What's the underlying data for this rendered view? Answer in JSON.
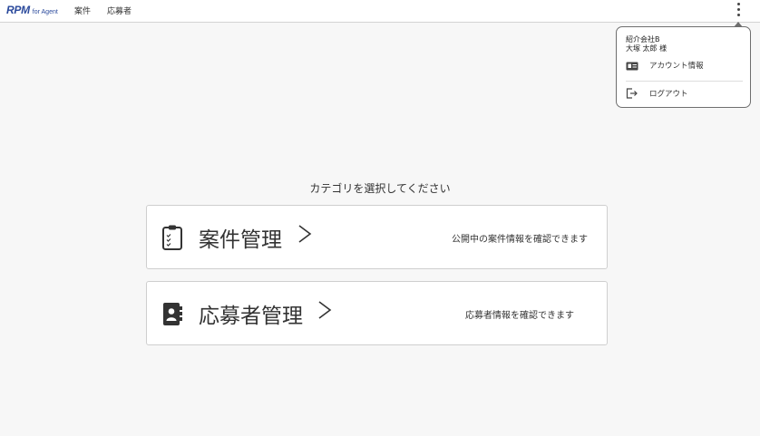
{
  "header": {
    "logo_main": "RPM",
    "logo_sub": "for Agent",
    "nav": [
      "案件",
      "応募者"
    ]
  },
  "user_menu": {
    "company": "紹介会社B",
    "user": "大塚 太郎 様",
    "items": [
      {
        "label": "アカウント情報",
        "icon": "id-card-icon"
      },
      {
        "label": "ログアウト",
        "icon": "logout-icon"
      }
    ]
  },
  "main": {
    "prompt": "カテゴリを選択してください",
    "cards": [
      {
        "title": "案件管理",
        "description": "公開中の案件情報を確認できます",
        "icon": "clipboard-checklist-icon"
      },
      {
        "title": "応募者管理",
        "description": "応募者情報を確認できます",
        "icon": "contact-book-icon"
      }
    ]
  },
  "colors": {
    "brand": "#2b4a9c",
    "background": "#f7f7f7",
    "text": "#333333"
  }
}
